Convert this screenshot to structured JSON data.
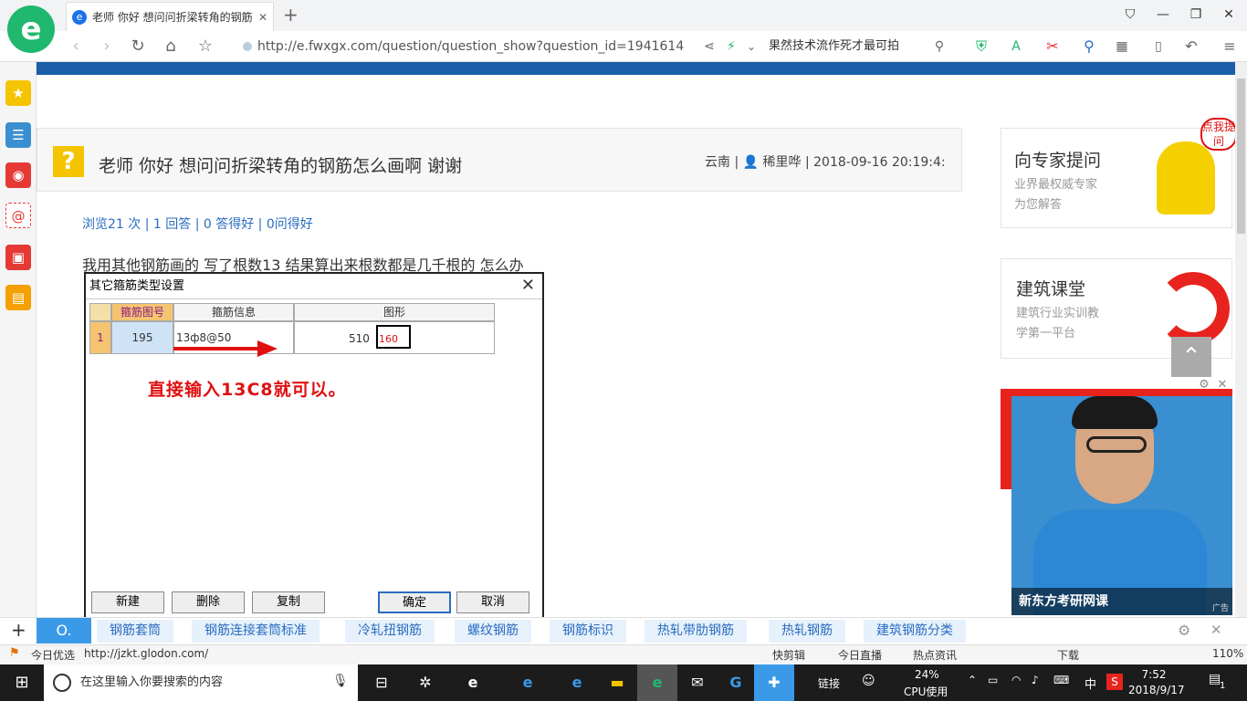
{
  "browser": {
    "tab_title": "老师 你好 想问问折梁转角的钢筋",
    "url": "http://e.fwxgx.com/question/question_show?question_id=1941614",
    "search_box": "果然技术流作死才最可拍"
  },
  "question": {
    "title": "老师 你好 想问问折梁转角的钢筋怎么画啊 谢谢",
    "location": "云南",
    "author": "稀里哗",
    "datetime": "2018-09-16 20:19:4:",
    "stats": "浏览21 次 | 1 回答 | 0 答得好 | 0问得好",
    "body": "我用其他钢筋画的   写了根数13   结果算出来根数都是几千根的  怎么办"
  },
  "dialog": {
    "title": "其它箍筋类型设置",
    "col_headers": [
      "箍筋图号",
      "箍筋信息",
      "图形"
    ],
    "row": {
      "index": "1",
      "figure_no": "195",
      "info": "13ф8@50",
      "value": "510",
      "shape_value": "160"
    },
    "note": "直接输入13C8就可以。",
    "buttons": [
      "新建",
      "删除",
      "复制",
      "确定",
      "取消"
    ]
  },
  "sidebar_right": {
    "card1": {
      "title": "向专家提问",
      "sub1": "业界最权威专家",
      "sub2": "为您解答",
      "badge": "点我提问"
    },
    "card2": {
      "title": "建筑课堂",
      "sub1": "建筑行业实训教",
      "sub2": "学第一平台"
    },
    "video_caption": "新东方考研网课",
    "ad_label": "广告"
  },
  "keywords": [
    "钢筋套筒",
    "钢筋连接套筒标准",
    "冷轧扭钢筋",
    "螺纹钢筋",
    "钢筋标识",
    "热轧带肋钢筋",
    "热轧钢筋",
    "建筑钢筋分类"
  ],
  "statusbar": {
    "left_label": "今日优选",
    "left_url": "http://jzkt.glodon.com/",
    "items": [
      "快剪辑",
      "今日直播",
      "热点资讯",
      "下载"
    ],
    "zoom": "110%"
  },
  "taskbar": {
    "search_placeholder": "在这里输入你要搜索的内容",
    "link_label": "链接",
    "cpu": "24%",
    "cpu_label": "CPU使用",
    "ime": "中",
    "time": "7:52",
    "date": "2018/9/17",
    "notification_count": "1"
  }
}
